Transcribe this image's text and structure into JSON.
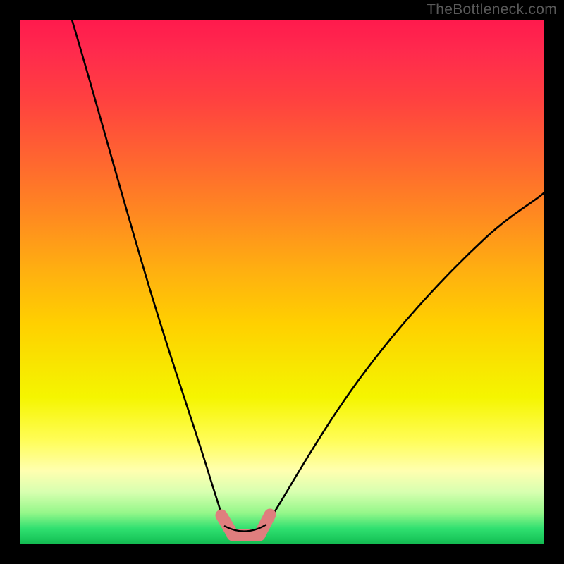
{
  "watermark": "TheBottleneck.com",
  "chart_data": {
    "type": "line",
    "title": "",
    "xlabel": "",
    "ylabel": "",
    "xlim": [
      0,
      100
    ],
    "ylim": [
      0,
      100
    ],
    "gradient_stops": [
      {
        "pos": 0,
        "color": "#ff1a4d"
      },
      {
        "pos": 15,
        "color": "#ff4040"
      },
      {
        "pos": 38,
        "color": "#ff8c1f"
      },
      {
        "pos": 58,
        "color": "#ffd000"
      },
      {
        "pos": 80,
        "color": "#fffd55"
      },
      {
        "pos": 94,
        "color": "#95f78a"
      },
      {
        "pos": 100,
        "color": "#13b850"
      }
    ],
    "series": [
      {
        "name": "left-curve",
        "x": [
          10,
          13,
          16,
          19,
          22,
          25,
          28,
          31,
          33,
          35,
          37,
          38.5
        ],
        "y": [
          100,
          87,
          74,
          62,
          50,
          39,
          29,
          20,
          13.5,
          9,
          5.5,
          3.5
        ]
      },
      {
        "name": "right-curve",
        "x": [
          47,
          49,
          52,
          56,
          61,
          67,
          74,
          82,
          91,
          100
        ],
        "y": [
          3.5,
          5,
          8,
          13,
          20,
          28,
          37,
          47,
          57,
          67
        ]
      },
      {
        "name": "bottom-segments-pink",
        "x": [
          38.5,
          40,
          41.5,
          43,
          44.5,
          46,
          47
        ],
        "y": [
          3.5,
          2,
          1.5,
          1.3,
          1.5,
          2,
          3.5
        ]
      }
    ],
    "highlight": {
      "color": "#e58080",
      "left": {
        "x_pct": [
          38.5,
          41
        ],
        "y_pct": [
          3.5,
          1.5
        ]
      },
      "mid": {
        "x_pct": [
          41,
          45.5
        ],
        "y_pct": [
          1.5,
          1.5
        ]
      },
      "right": {
        "x_pct": [
          45.5,
          47.5
        ],
        "y_pct": [
          1.5,
          4
        ]
      }
    }
  }
}
